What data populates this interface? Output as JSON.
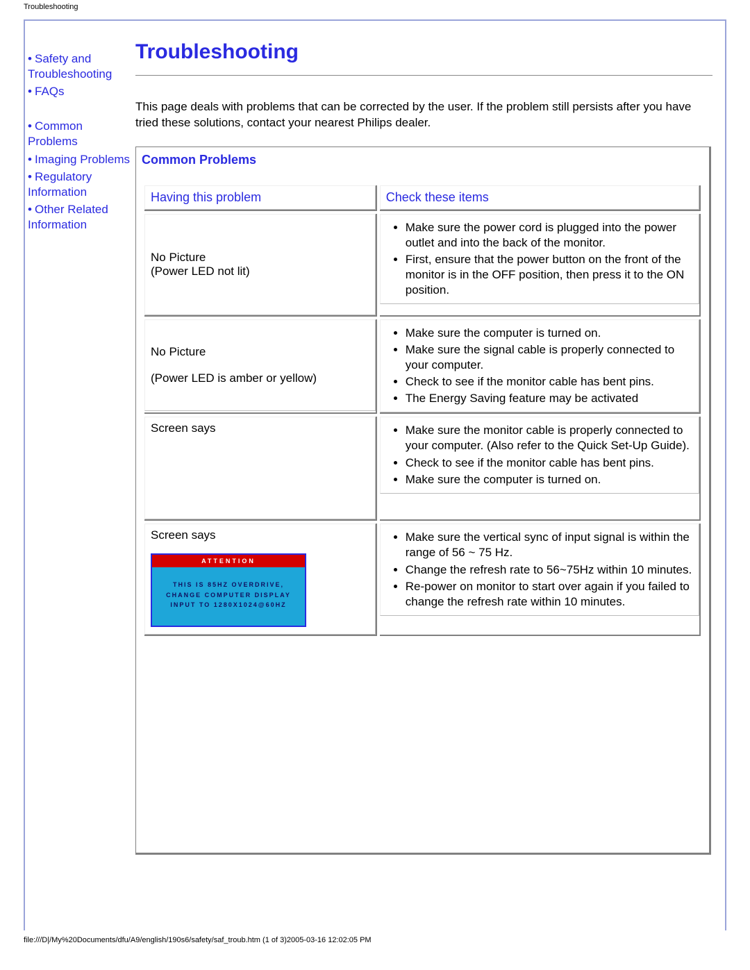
{
  "header": "Troubleshooting",
  "title": "Troubleshooting",
  "sidebar": {
    "items": [
      "Safety and Troubleshooting",
      "FAQs",
      "",
      "Common Problems",
      "Imaging Problems",
      "Regulatory Information",
      "Other Related Information"
    ]
  },
  "intro": "This page deals with problems that can be corrected by the user. If the problem still persists after you have tried these solutions, contact your nearest Philips dealer.",
  "section_title": "Common Problems",
  "table": {
    "head_left": "Having this problem",
    "head_right": "Check these items",
    "rows": [
      {
        "problem_line1": "No Picture",
        "problem_line2": "(Power LED not lit)",
        "checks": [
          "Make sure the power cord is plugged into the power outlet and into the back of the monitor.",
          "First, ensure that the power button on the front of the monitor is in the OFF position, then press it to the ON position."
        ]
      },
      {
        "problem_line1": "No Picture",
        "problem_line2": "(Power LED is amber or yellow)",
        "gap": true,
        "checks": [
          "Make sure the computer is turned on.",
          "Make sure the signal cable is properly connected to your computer.",
          "Check to see if the monitor cable has bent pins.",
          "The Energy Saving feature may be activated"
        ]
      },
      {
        "problem_line1": "Screen says",
        "problem_line2": "",
        "checks": [
          "Make sure the monitor cable is properly connected to your computer. (Also refer to the Quick Set-Up Guide).",
          "Check to see if the monitor cable has bent pins.",
          "Make sure the computer is turned on."
        ]
      },
      {
        "problem_line1": "Screen says",
        "problem_line2": "",
        "attention": {
          "bar": "ATTENTION",
          "line1": "THIS IS 85HZ OVERDRIVE,",
          "line2": "CHANGE COMPUTER DISPLAY",
          "line3": "INPUT TO 1280X1024@60HZ"
        },
        "checks": [
          "Make sure the vertical sync of input signal is within the range of 56 ~ 75 Hz.",
          "Change the refresh rate to 56~75Hz within 10 minutes.",
          "Re-power on monitor to start over again if you failed to change the refresh rate within 10 minutes."
        ]
      }
    ]
  },
  "footer": "file:///D|/My%20Documents/dfu/A9/english/190s6/safety/saf_troub.htm (1 of 3)2005-03-16 12:02:05 PM"
}
